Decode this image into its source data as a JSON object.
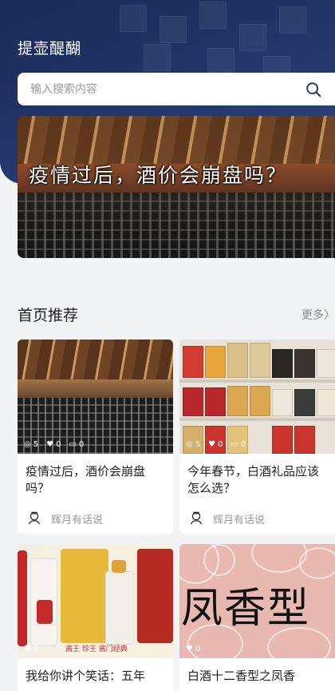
{
  "header": {
    "title": "提壶醍醐",
    "search_placeholder": "输入搜索内容"
  },
  "banner": {
    "caption": "疫情过后，酒价会崩盘吗？"
  },
  "section": {
    "title": "首页推荐",
    "more_label": "更多"
  },
  "cards": [
    {
      "views": "5",
      "likes": "0",
      "comments": "0",
      "title": "疫情过后，酒价会崩盘吗？",
      "author": "辉月有话说"
    },
    {
      "views": "5",
      "likes": "0",
      "comments": "0",
      "title": "今年春节，白酒礼品应该怎么选？",
      "author": "辉月有话说"
    },
    {
      "views": "",
      "likes": "0",
      "comments": "",
      "title": "我给你讲个笑话：五年",
      "image_text": [
        "酱王",
        "珍王",
        "酱门经典"
      ],
      "author": ""
    },
    {
      "views": "",
      "likes": "0",
      "comments": "",
      "title": "白酒十二香型之凤香",
      "image_text": "凤香型",
      "author": ""
    }
  ],
  "colors": {
    "header_bg": "#23376b",
    "page_bg": "#f2f3f5",
    "text_primary": "#222222",
    "text_muted": "#999999"
  }
}
